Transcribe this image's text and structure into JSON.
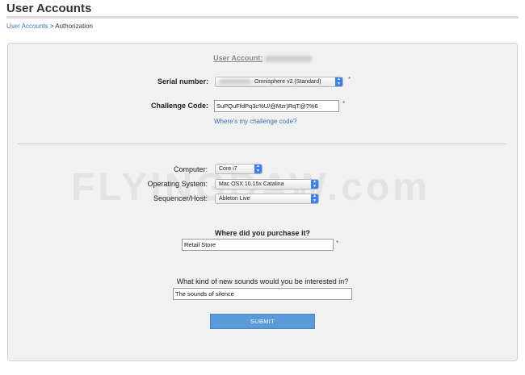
{
  "header": {
    "title": "User Accounts"
  },
  "breadcrumb": {
    "link": "User Accounts",
    "separator": ">",
    "current": "Authorization"
  },
  "account": {
    "label": "User Account:"
  },
  "form": {
    "serial": {
      "label": "Serial number:",
      "product": "Omnisphere v2 (Standard)",
      "required": "*"
    },
    "challenge": {
      "label": "Challenge Code:",
      "value": "SuPQuFfdPq3c%U/@Mzr)RqT@?%6",
      "required": "*",
      "help": "Where's my challenge code?"
    },
    "computer": {
      "label": "Computer:",
      "value": "Core i7"
    },
    "os": {
      "label": "Operating System:",
      "value": "Mac OSX 10.15x Catalina"
    },
    "host": {
      "label": "Sequencer/Host:",
      "value": "Ableton Live"
    },
    "purchase": {
      "question": "Where did you purchase it?",
      "value": "Retail Store",
      "required": "*"
    },
    "sounds": {
      "question": "What kind of new sounds would you be interested in?",
      "value": "The sounds of silence"
    },
    "submit_label": "SUBMIT"
  },
  "watermark": "FLYINGDAW.com",
  "colors": {
    "accent": "#3b82f0",
    "link": "#3b7bbf",
    "submit": "#5b9ad9",
    "required": "#e0302c"
  },
  "icons": {
    "select_arrow": "chevron-updown-icon"
  }
}
